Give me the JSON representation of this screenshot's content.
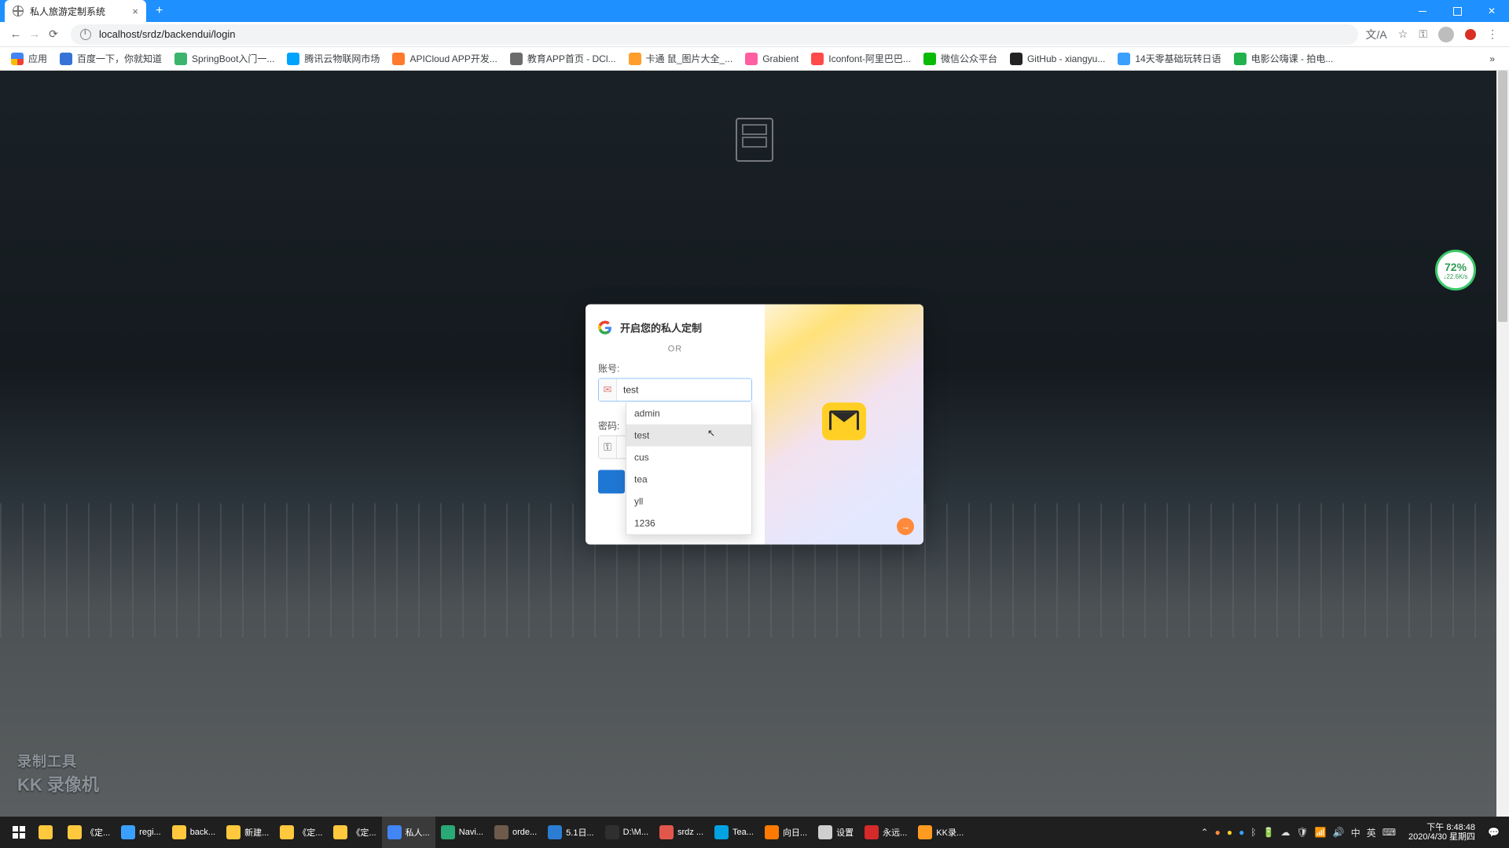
{
  "window": {
    "tab_title": "私人旅游定制系统"
  },
  "addressbar": {
    "url": "localhost/srdz/backendui/login",
    "translate_icon": "translate-icon",
    "star_icon": "star-icon",
    "key_icon": "key-icon"
  },
  "bookmarks": {
    "apps": "应用",
    "items": [
      {
        "label": "百度一下，你就知道",
        "color": "#3673d6"
      },
      {
        "label": "SpringBoot入门一...",
        "color": "#3db46d"
      },
      {
        "label": "腾讯云物联网市场",
        "color": "#00a4ff"
      },
      {
        "label": "APICloud APP开发...",
        "color": "#ff7a2d"
      },
      {
        "label": "教育APP首页 - DCl...",
        "color": "#6b6b6b"
      },
      {
        "label": "卡通 鼠_图片大全_...",
        "color": "#ff9e2d"
      },
      {
        "label": "Grabient",
        "color": "#ff5fa2"
      },
      {
        "label": "Iconfont-阿里巴巴...",
        "color": "#ff4a4a"
      },
      {
        "label": "微信公众平台",
        "color": "#09bb07"
      },
      {
        "label": "GitHub - xiangyu...",
        "color": "#222222"
      },
      {
        "label": "14天零基础玩转日语",
        "color": "#3aa0ff"
      },
      {
        "label": "电影公嗨课 - 拍电...",
        "color": "#22b14c"
      }
    ]
  },
  "login": {
    "brand_text": "开启您的私人定制",
    "or": "OR",
    "account_label": "账号:",
    "password_label": "密码:",
    "account_value": "test",
    "password_value": "",
    "suggestions": [
      "admin",
      "test",
      "cus",
      "tea",
      "yll",
      "1236"
    ],
    "hover_index": 1
  },
  "perf": {
    "value": "72",
    "unit": "%",
    "rate": "↓22.6K/s"
  },
  "watermark": {
    "line1": "录制工具",
    "line2": "KK 录像机"
  },
  "taskbar": {
    "items": [
      {
        "label": "",
        "color": "#ffc83d"
      },
      {
        "label": "《定...",
        "color": "#ffc83d"
      },
      {
        "label": "regi...",
        "color": "#3aa0ff"
      },
      {
        "label": "back...",
        "color": "#ffc83d"
      },
      {
        "label": "新建...",
        "color": "#ffc83d"
      },
      {
        "label": "《定...",
        "color": "#ffc83d"
      },
      {
        "label": "《定...",
        "color": "#ffc83d"
      },
      {
        "label": "私人...",
        "color": "#4285f4",
        "active": true
      },
      {
        "label": "Navi...",
        "color": "#2aa876"
      },
      {
        "label": "orde...",
        "color": "#6e5a4b"
      },
      {
        "label": "5.1日...",
        "color": "#2b7cd3"
      },
      {
        "label": "D:\\M...",
        "color": "#2f2f2f"
      },
      {
        "label": "srdz ...",
        "color": "#e2574c"
      },
      {
        "label": "Tea...",
        "color": "#00a2e1"
      },
      {
        "label": "向日...",
        "color": "#ff7a00"
      },
      {
        "label": "设置",
        "color": "#cfcfcf"
      },
      {
        "label": "永远...",
        "color": "#d42a2a"
      },
      {
        "label": "KK录...",
        "color": "#ff9b21"
      }
    ],
    "clock_time": "下午 8:48:48",
    "clock_date": "2020/4/30 星期四"
  }
}
